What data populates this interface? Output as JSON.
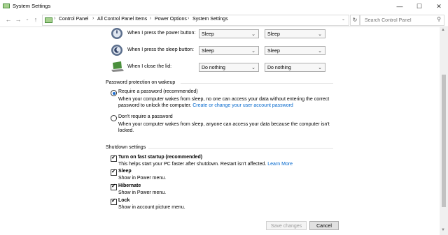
{
  "window": {
    "title": "System Settings"
  },
  "address": {
    "crumbs": [
      "Control Panel",
      "All Control Panel Items",
      "Power Options",
      "System Settings"
    ],
    "search_placeholder": "Search Control Panel"
  },
  "power_rows": [
    {
      "label": "When I press the power button:",
      "on_battery": "Sleep",
      "plugged_in": "Sleep"
    },
    {
      "label": "When I press the sleep button:",
      "on_battery": "Sleep",
      "plugged_in": "Sleep"
    },
    {
      "label": "When I close the lid:",
      "on_battery": "Do nothing",
      "plugged_in": "Do nothing"
    }
  ],
  "password": {
    "heading": "Password protection on wakeup",
    "require_label": "Require a password (recommended)",
    "require_desc_1": "When your computer wakes from sleep, no one can access your data without entering the correct",
    "require_desc_2": "password to unlock the computer.",
    "require_link": "Create or change your user account password",
    "norequire_label": "Don't require a password",
    "norequire_desc_1": "When your computer wakes from sleep, anyone can access your data because the computer isn't",
    "norequire_desc_2": "locked."
  },
  "shutdown": {
    "heading": "Shutdown settings",
    "fast_label": "Turn on fast startup (recommended)",
    "fast_desc": "This helps start your PC faster after shutdown. Restart isn't affected.",
    "fast_link": "Learn More",
    "sleep_label": "Sleep",
    "sleep_desc": "Show in Power menu.",
    "hibernate_label": "Hibernate",
    "hibernate_desc": "Show in Power menu.",
    "lock_label": "Lock",
    "lock_desc": "Show in account picture menu."
  },
  "footer": {
    "save_label": "Save changes",
    "cancel_label": "Cancel"
  },
  "colors": {
    "link": "#0066cc",
    "radio_selected": "#1f6fd1"
  }
}
